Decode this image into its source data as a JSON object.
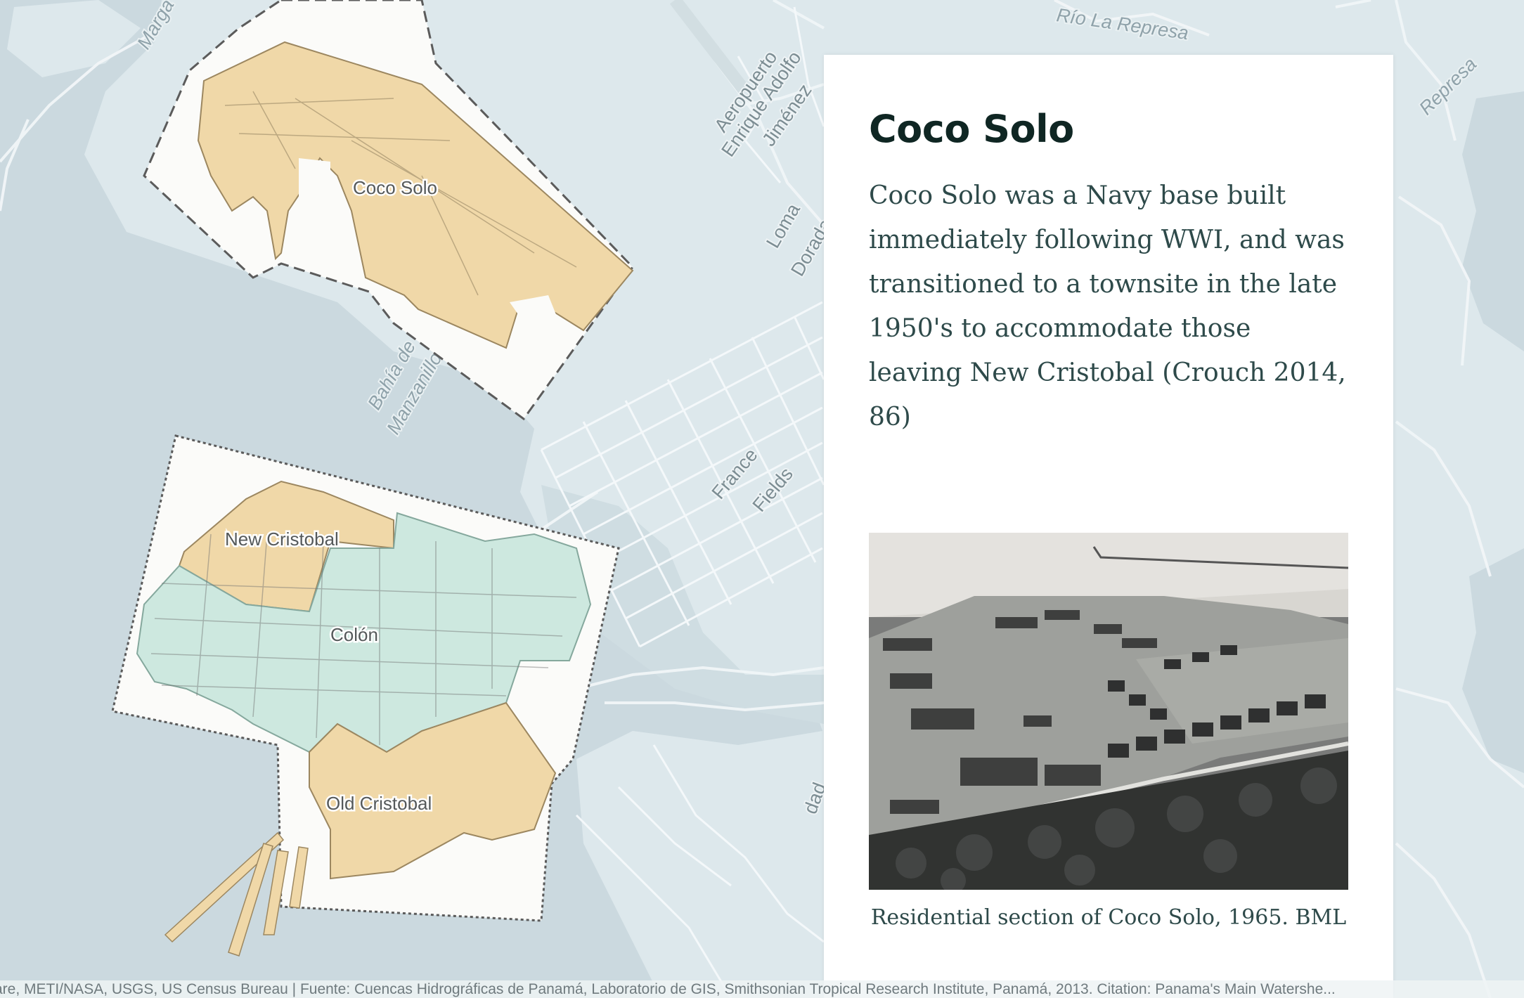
{
  "map": {
    "labels": {
      "marg": "Marga",
      "rio_la_represa": "Río La Represa",
      "represa": "Represa",
      "airport": [
        "Aeropuerto",
        "Enrique Adolfo",
        "Jiménez"
      ],
      "loma_dorada": [
        "Loma",
        "Dorada"
      ],
      "france_fields": [
        "France",
        "Fields"
      ],
      "bahia": [
        "Bahía de",
        "Manzanillo"
      ],
      "dad": "dad"
    },
    "overlays": {
      "coco_solo_label": "Coco Solo",
      "new_cristobal_label": "New Cristobal",
      "colon_label": "Colón",
      "old_cristobal_label": "Old Cristobal"
    },
    "colors": {
      "water": "#cbd9df",
      "land": "#dde8ec",
      "road": "#f1f6f8",
      "tan_area": "#f0d8a8",
      "teal_area": "#cde8df"
    }
  },
  "card": {
    "title": "Coco Solo",
    "body": "Coco Solo was a Navy base built immediately following WWI, and was transitioned to a townsite in the late 1950's to accommodate those leaving New Cristobal (Crouch 2014, 86)",
    "image_caption": "Residential section of Coco Solo, 1965. BML"
  },
  "attribution": "are, METI/NASA, USGS, US Census Bureau | Fuente: Cuencas Hidrográficas de Panamá, Laboratorio de GIS, Smithsonian Tropical Research Institute, Panamá, 2013. Citation: Panama's Main Watershe..."
}
